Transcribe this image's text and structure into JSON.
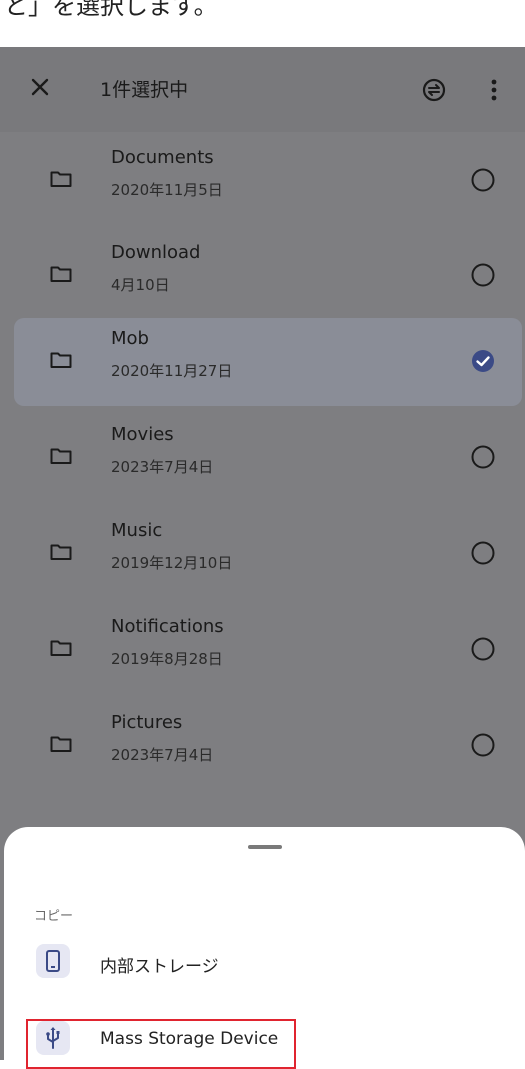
{
  "caption": "と」を選択します。",
  "appbar": {
    "title": "1件選択中",
    "close_icon": "close-icon",
    "sync_icon": "sync-icon",
    "more_icon": "more-vertical-icon"
  },
  "folders": [
    {
      "name": "Documents",
      "date": "2020年11月5日",
      "selected": false
    },
    {
      "name": "Download",
      "date": "4月10日",
      "selected": false
    },
    {
      "name": "Mob",
      "date": "2020年11月27日",
      "selected": true
    },
    {
      "name": "Movies",
      "date": "2023年7月4日",
      "selected": false
    },
    {
      "name": "Music",
      "date": "2019年12月10日",
      "selected": false
    },
    {
      "name": "Notifications",
      "date": "2019年8月28日",
      "selected": false
    },
    {
      "name": "Pictures",
      "date": "2023年7月4日",
      "selected": false
    }
  ],
  "sheet": {
    "heading": "コピー",
    "items": [
      {
        "label": "内部ストレージ",
        "icon": "phone-icon"
      },
      {
        "label": "Mass Storage Device",
        "icon": "usb-icon"
      }
    ]
  },
  "colors": {
    "overlay": "#7e7e81",
    "selected_row": "#8a8d97",
    "check": "#3b4a86",
    "highlight": "#e0242f"
  }
}
